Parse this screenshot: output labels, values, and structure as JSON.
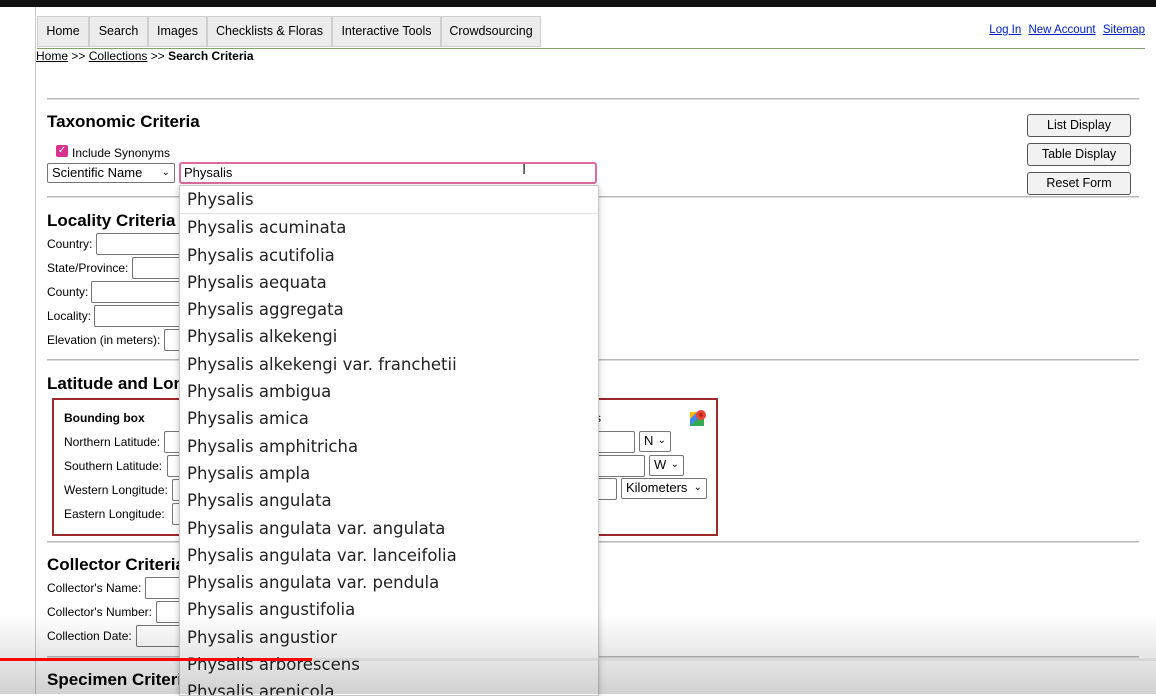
{
  "nav": {
    "menu": [
      "Home",
      "Search",
      "Images",
      "Checklists & Floras",
      "Interactive Tools",
      "Crowdsourcing"
    ],
    "links": [
      "Log In",
      "New Account",
      "Sitemap"
    ]
  },
  "breadcrumb": {
    "home": "Home",
    "sep1": ">>",
    "collections": "Collections",
    "sep2": ">>",
    "current": "Search Criteria"
  },
  "taxonomic": {
    "heading": "Taxonomic Criteria",
    "include_synonyms": "Include Synonyms",
    "type_select": "Scientific Name",
    "taxon_value": "Physalis"
  },
  "buttons": {
    "list_display": "List Display",
    "table_display": "Table Display",
    "reset_form": "Reset Form"
  },
  "locality": {
    "heading": "Locality Criteria",
    "country": "Country:",
    "state": "State/Province:",
    "county": "County:",
    "locality": "Locality:",
    "elevation": "Elevation (in meters):"
  },
  "latlong": {
    "heading": "Latitude and Longitude",
    "bbox_title": "Bounding box",
    "north": "Northern Latitude:",
    "south": "Southern Latitude:",
    "west": "Western Longitude:",
    "east": "Eastern Longitude:",
    "lat_dir": "N",
    "long_dir": "W",
    "units": "Kilometers",
    "map_icon": "map-pin-icon"
  },
  "collector": {
    "heading": "Collector Criteria",
    "name": "Collector's Name:",
    "number": "Collector's Number:",
    "date": "Collection Date:"
  },
  "specimen": {
    "heading": "Specimen Criteria"
  },
  "autocomplete": [
    "Physalis",
    "Physalis acuminata",
    "Physalis acutifolia",
    "Physalis aequata",
    "Physalis aggregata",
    "Physalis alkekengi",
    "Physalis alkekengi var. franchetii",
    "Physalis ambigua",
    "Physalis amica",
    "Physalis amphitricha",
    "Physalis ampla",
    "Physalis angulata",
    "Physalis angulata var. angulata",
    "Physalis angulata var. lanceifolia",
    "Physalis angulata var. pendula",
    "Physalis angustifolia",
    "Physalis angustior",
    "Physalis arborescens",
    "Physalis arenicola"
  ],
  "video": {
    "progress": 0.27,
    "accent": "#ff0000"
  },
  "colors": {
    "checkbox": "#d6338e",
    "input_focus": "#e06b9e",
    "bbox_border": "#9c2a2a",
    "link": "#0020c8"
  }
}
